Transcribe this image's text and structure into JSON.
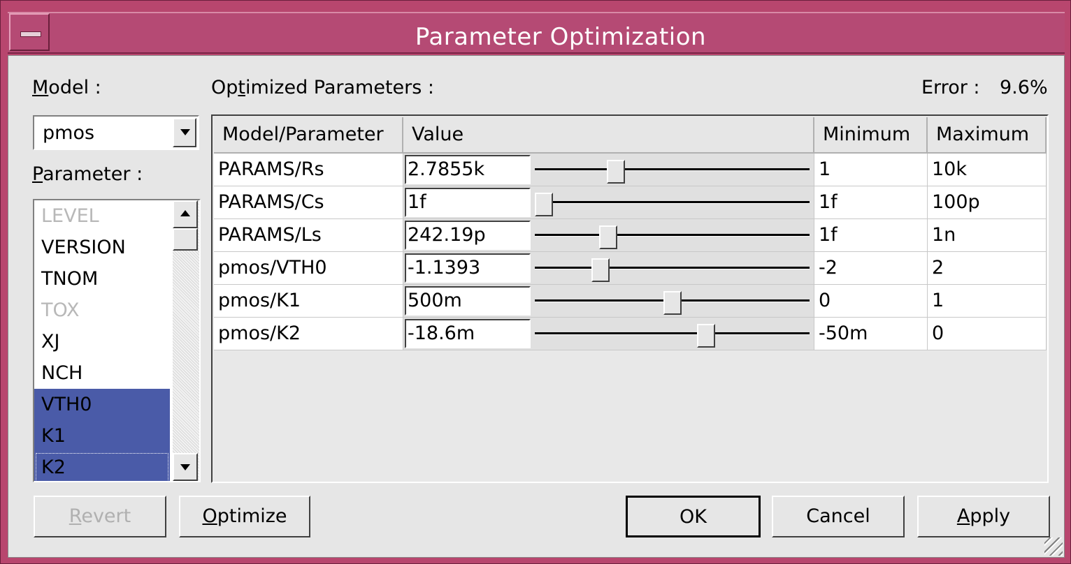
{
  "window": {
    "title": "Parameter Optimization"
  },
  "model": {
    "label_accel": "M",
    "label_rest": "odel :",
    "selected": "pmos"
  },
  "parameter": {
    "label_accel": "P",
    "label_rest": "arameter :",
    "items": [
      {
        "name": "LEVEL",
        "state": "disabled"
      },
      {
        "name": "VERSION",
        "state": "normal"
      },
      {
        "name": "TNOM",
        "state": "normal"
      },
      {
        "name": "TOX",
        "state": "disabled"
      },
      {
        "name": "XJ",
        "state": "normal"
      },
      {
        "name": "NCH",
        "state": "normal"
      },
      {
        "name": "VTH0",
        "state": "selected"
      },
      {
        "name": "K1",
        "state": "selected"
      },
      {
        "name": "K2",
        "state": "selected"
      }
    ]
  },
  "optimized": {
    "label_pre": "Op",
    "label_accel": "t",
    "label_rest": "imized Parameters :",
    "error_label": "Error :",
    "error_value": "9.6%",
    "columns": [
      "Model/Parameter",
      "Value",
      "Minimum",
      "Maximum"
    ],
    "rows": [
      {
        "param": "PARAMS/Rs",
        "value": "2.7855k",
        "min": "1",
        "max": "10k",
        "slider_fraction": 0.28
      },
      {
        "param": "PARAMS/Cs",
        "value": "1f",
        "min": "1f",
        "max": "100p",
        "slider_fraction": 0.0
      },
      {
        "param": "PARAMS/Ls",
        "value": "242.19p",
        "min": "1f",
        "max": "1n",
        "slider_fraction": 0.25
      },
      {
        "param": "pmos/VTH0",
        "value": "-1.1393",
        "min": "-2",
        "max": "2",
        "slider_fraction": 0.22
      },
      {
        "param": "pmos/K1",
        "value": "500m",
        "min": "0",
        "max": "1",
        "slider_fraction": 0.5
      },
      {
        "param": "pmos/K2",
        "value": "-18.6m",
        "min": "-50m",
        "max": "0",
        "slider_fraction": 0.63
      }
    ]
  },
  "buttons": {
    "revert_accel": "R",
    "revert_rest": "evert",
    "optimize_accel": "O",
    "optimize_rest": "ptimize",
    "ok": "OK",
    "cancel": "Cancel",
    "apply_accel": "A",
    "apply_rest": "pply"
  },
  "colors": {
    "titlebar": "#b54a74",
    "selection": "#4a5ba8"
  }
}
